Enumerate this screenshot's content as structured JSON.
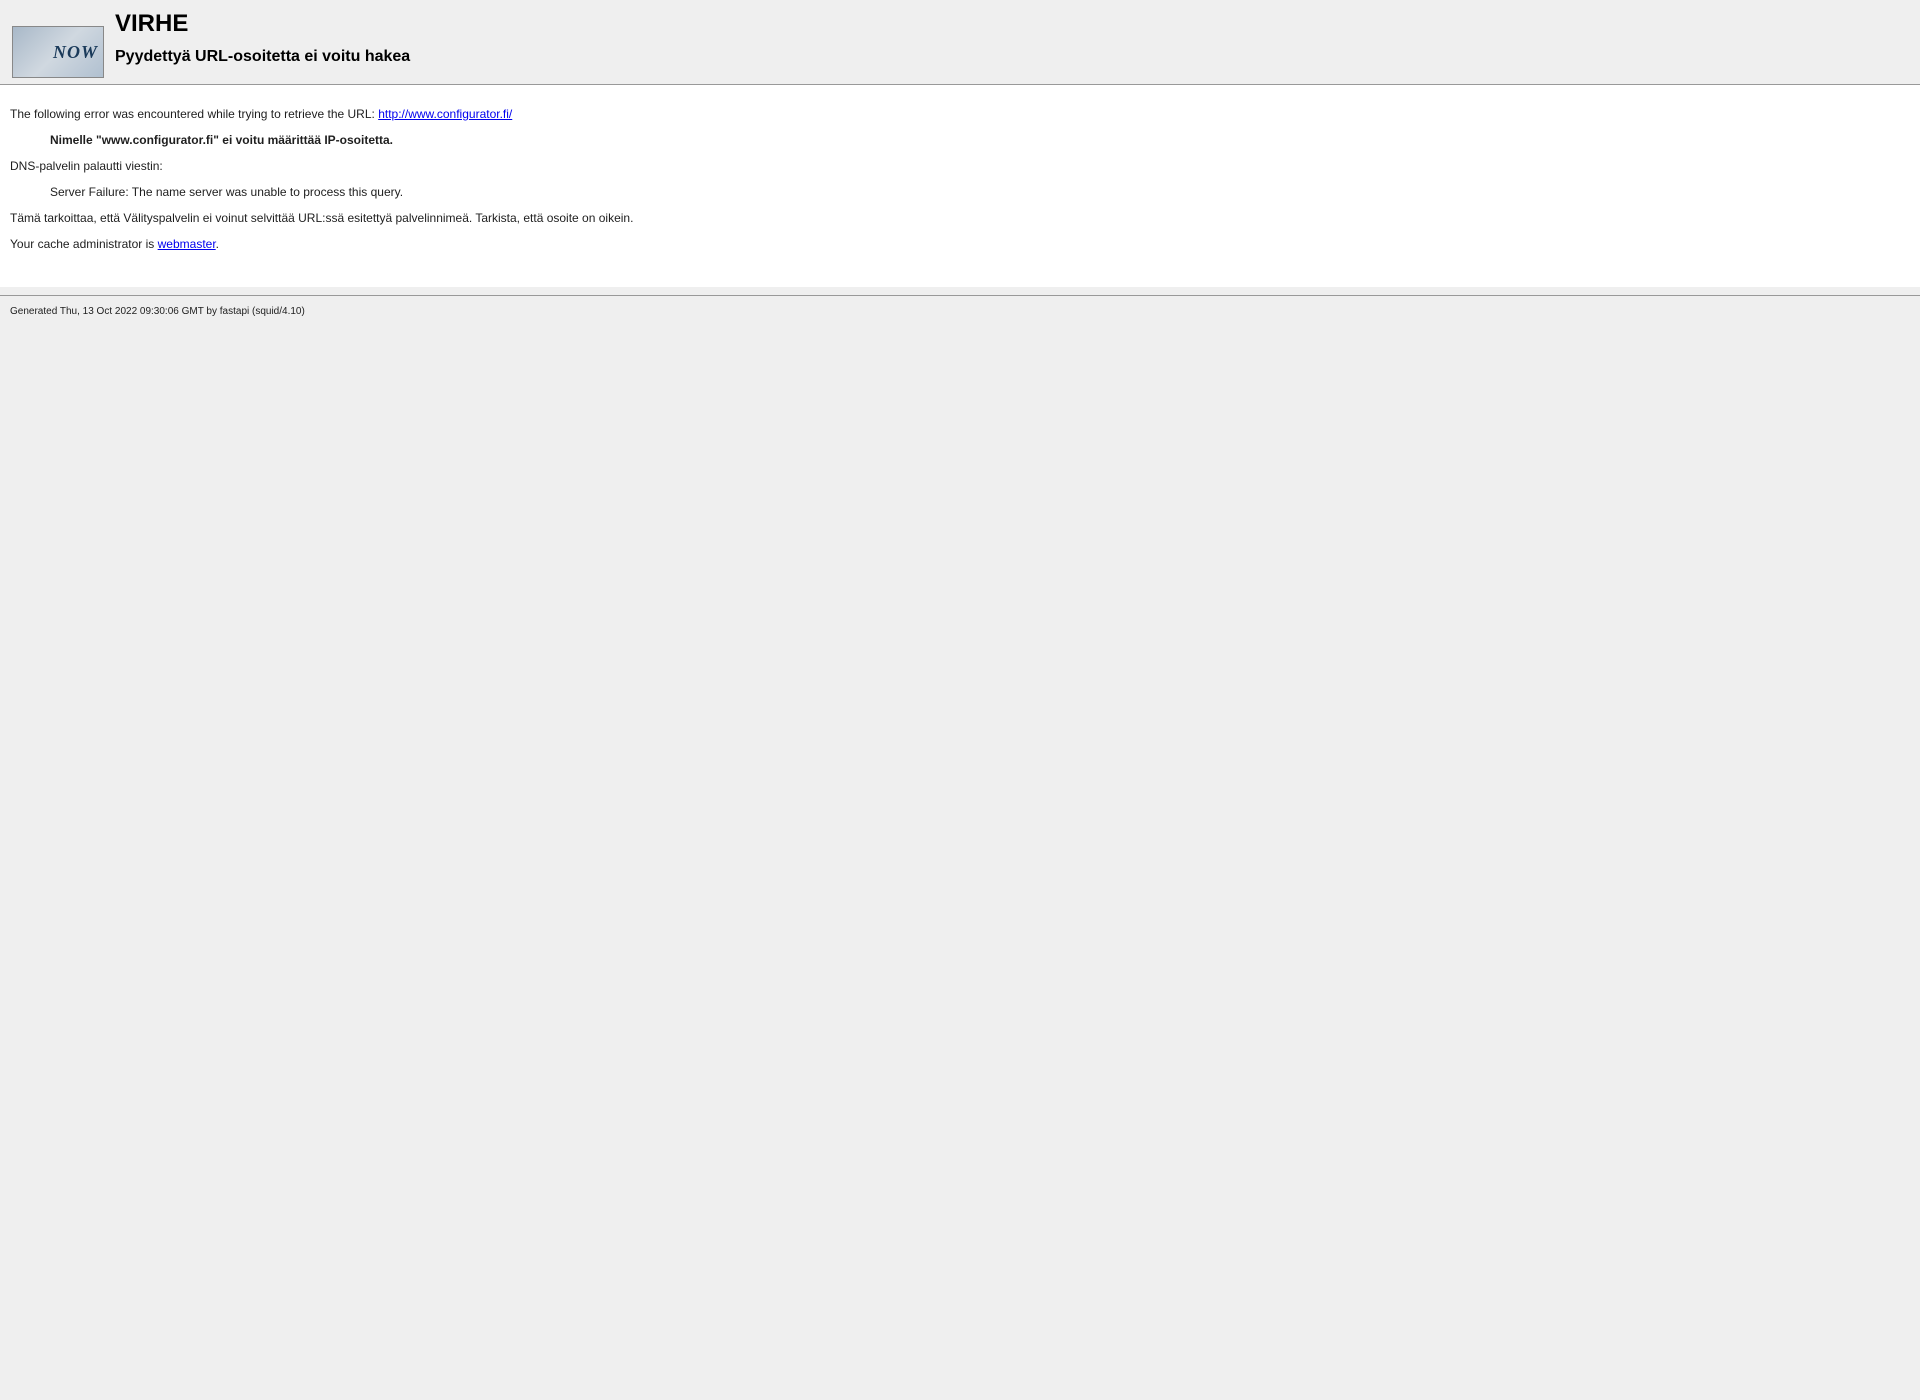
{
  "header": {
    "icon_text": "NOW",
    "title": "VIRHE",
    "subtitle": "Pyydettyä URL-osoitetta ei voitu hakea"
  },
  "content": {
    "intro_text": "The following error was encountered while trying to retrieve the URL: ",
    "url": "http://www.configurator.fi/",
    "error_message": "Nimelle \"www.configurator.fi\" ei voitu määrittää IP-osoitetta.",
    "dns_text": "DNS-palvelin palautti viestin:",
    "server_failure": "Server Failure: The name server was unable to process this query.",
    "explanation": "Tämä tarkoittaa, että Välityspalvelin ei voinut selvittää URL:ssä esitettyä palvelinnimeä. Tarkista, että osoite on oikein.",
    "admin_text": "Your cache administrator is ",
    "admin_link": "webmaster",
    "admin_period": "."
  },
  "footer": {
    "generated": "Generated Thu, 13 Oct 2022 09:30:06 GMT by fastapi (squid/4.10)"
  }
}
